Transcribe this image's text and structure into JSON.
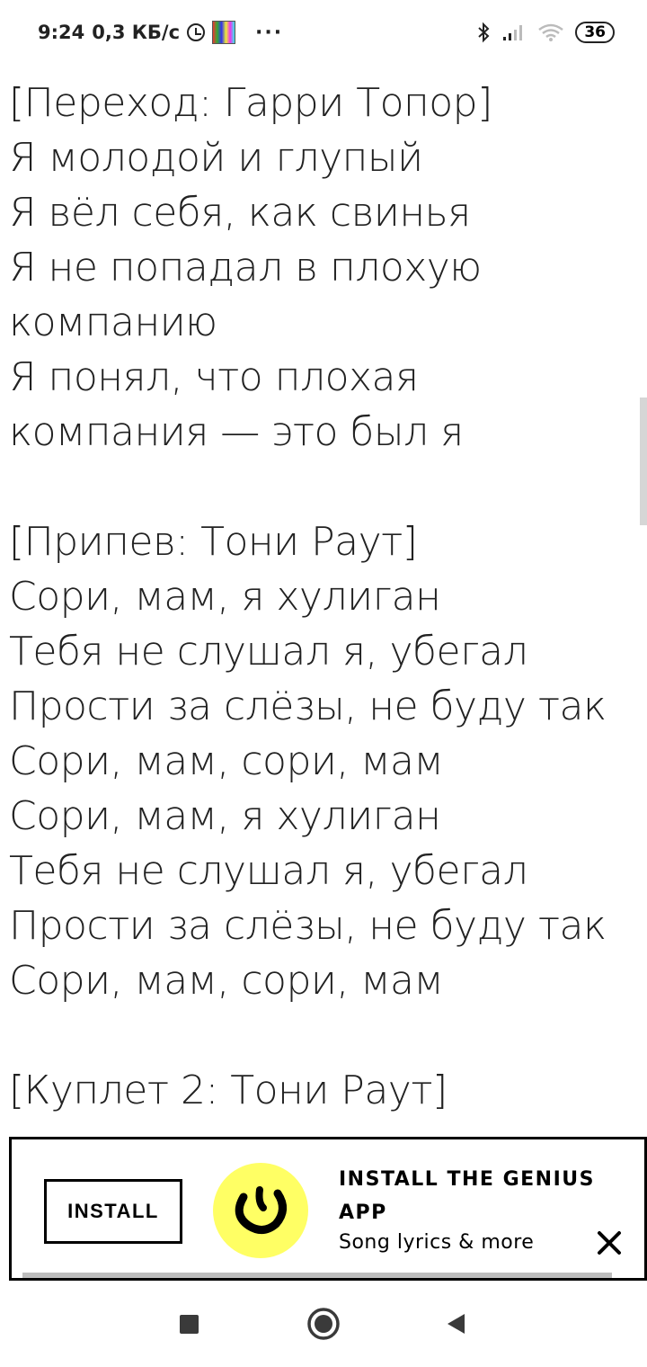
{
  "status_bar": {
    "time": "9:24",
    "speed": "0,3 КБ/с",
    "more": "···",
    "battery": "36",
    "icons": [
      "alarm-icon",
      "gallery-thumbnail-icon",
      "bluetooth-icon",
      "cell-signal-icon",
      "wifi-icon",
      "battery-icon"
    ]
  },
  "lyrics": {
    "section1_header": "[Переход: Гарри Топор]",
    "section1_lines": [
      "Я молодой и глупый",
      "Я вёл себя, как свинья",
      "Я не попадал в плохую компанию",
      "Я понял, что плохая компания — это был я"
    ],
    "section2_header": "[Припев: Тони Раут]",
    "section2_lines": [
      "Сори, мам, я хулиган",
      "Тебя не слушал я, убегал",
      "Прости за слёзы, не буду так",
      "Сори, мам, сори, мам",
      "Сори, мам, я хулиган",
      "Тебя не слушал я, убегал",
      "Прости за слёзы, не буду так",
      "Сори, мам, сори, мам"
    ],
    "section3_header": "[Куплет 2: Тони Раут]"
  },
  "banner": {
    "install_label": "INSTALL",
    "title": "INSTALL THE GENIUS APP",
    "subtitle": "Song lyrics & more",
    "logo_color": "#ffff64",
    "icons": [
      "genius-logo-icon",
      "close-icon"
    ]
  },
  "nav_bar": {
    "icons": [
      "recents-square-icon",
      "home-circle-icon",
      "back-triangle-icon"
    ]
  }
}
